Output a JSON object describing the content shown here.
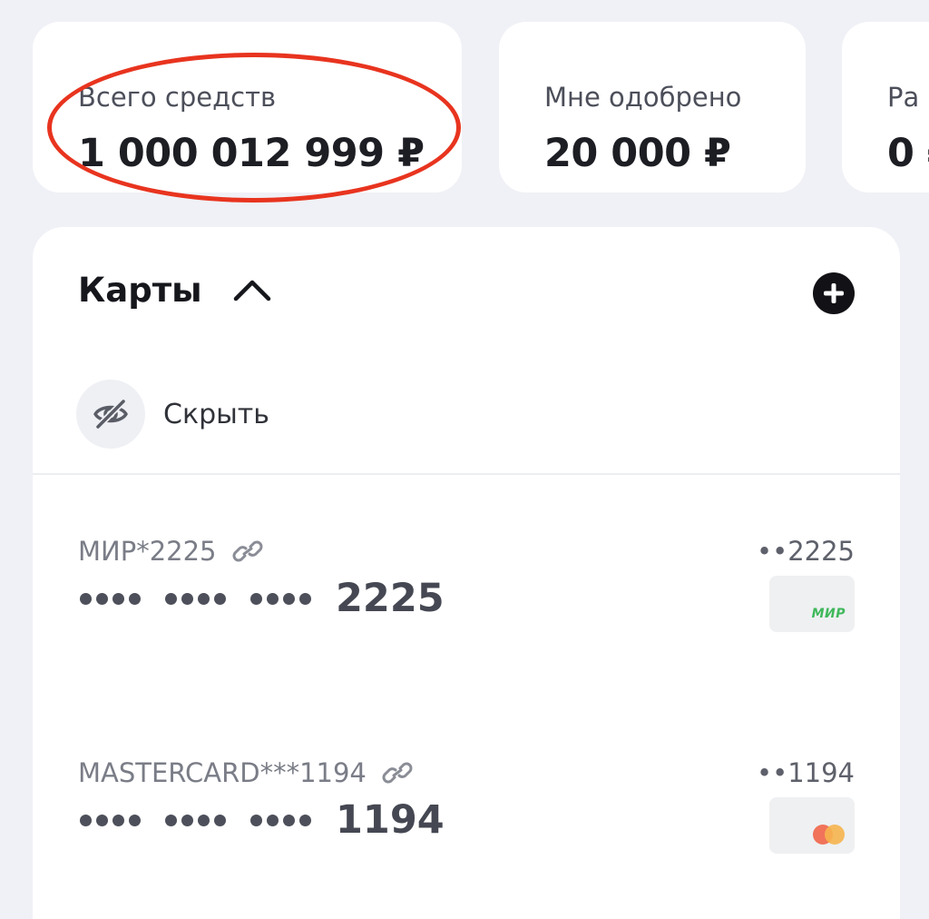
{
  "summary": {
    "total": {
      "label": "Всего средств",
      "value": "1 000 012 999 ₽"
    },
    "approved": {
      "label": "Мне одобрено",
      "value": "20 000 ₽"
    },
    "third": {
      "label": "Ра",
      "value": "0 ₽"
    }
  },
  "cards_section": {
    "title": "Карты",
    "hide_label": "Скрыть",
    "cards": [
      {
        "name": "МИР*2225",
        "number_last4": "2225",
        "short_last4": "••2225",
        "brand": "МИР",
        "brand_color": "#3fb85a"
      },
      {
        "name": "MASTERCARD***1194",
        "number_last4": "1194",
        "short_last4": "••1194",
        "brand": "mastercard"
      }
    ]
  },
  "colors": {
    "background": "#f0f1f6",
    "highlight": "#e8341f",
    "add_button": "#121216"
  }
}
